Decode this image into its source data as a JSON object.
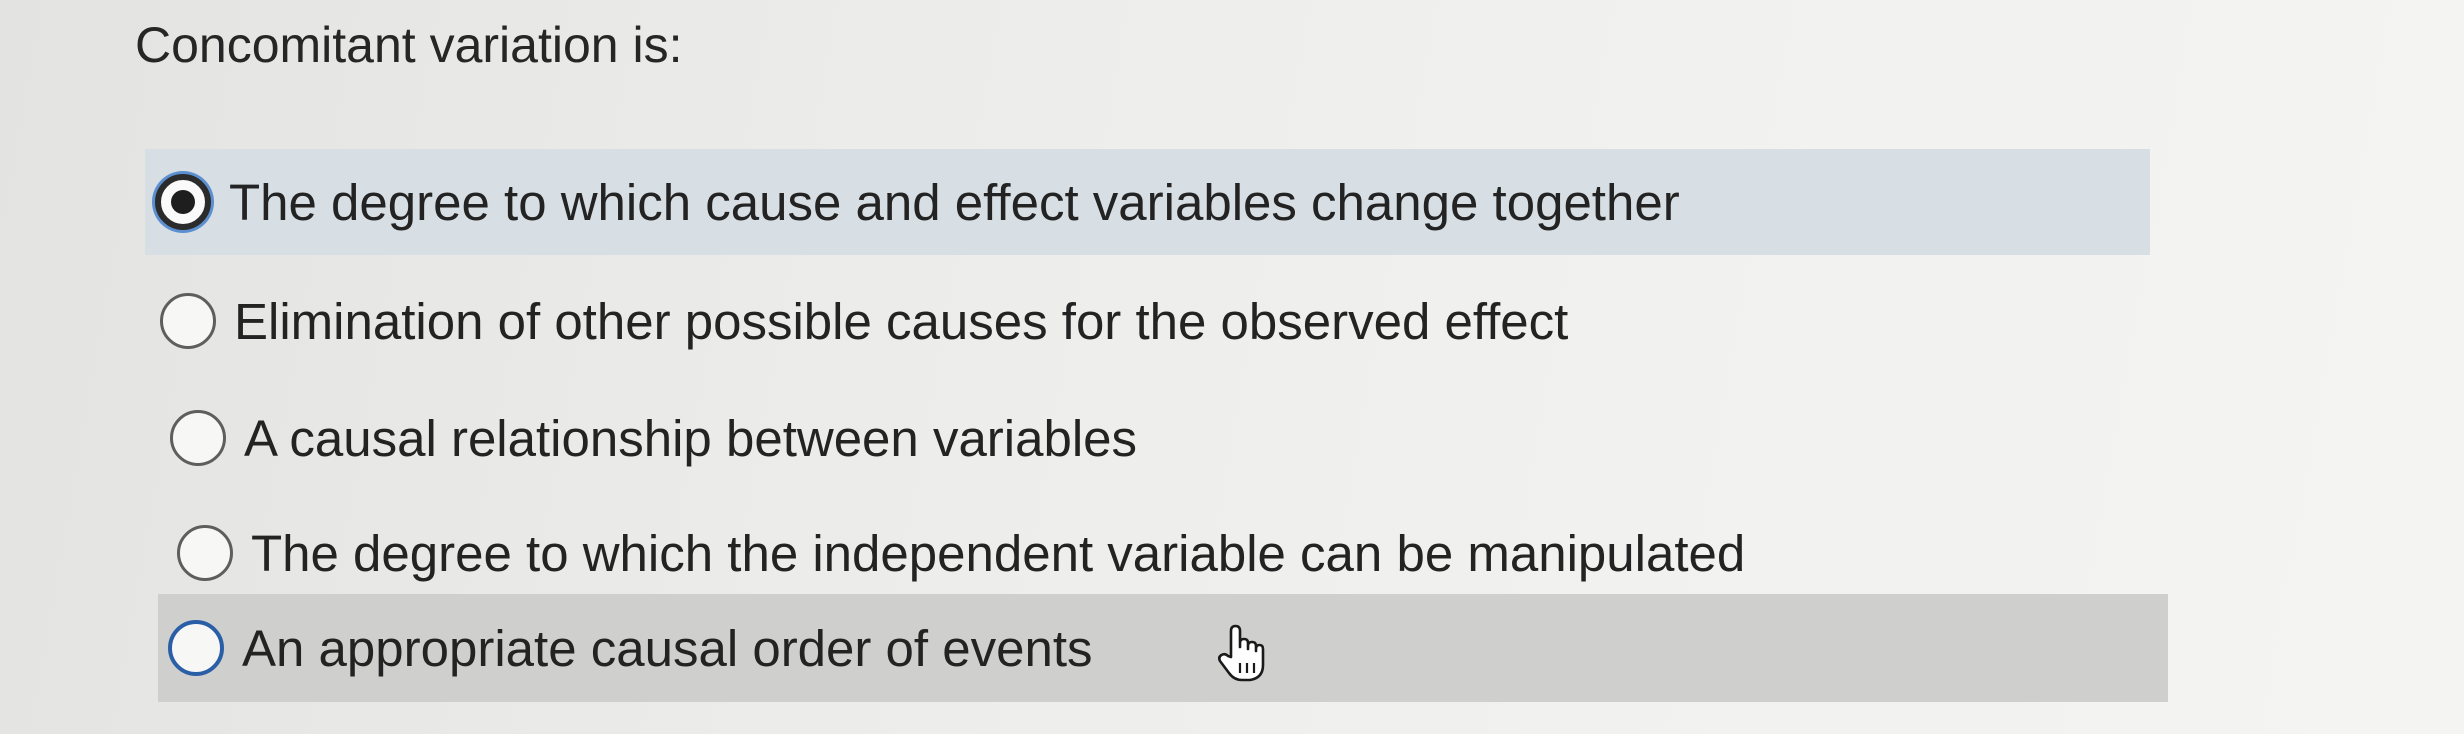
{
  "question": {
    "text": "Concomitant variation is:"
  },
  "options": [
    {
      "label": "The degree to which cause and effect variables change together",
      "selected": true
    },
    {
      "label": "Elimination of other possible causes for the observed effect",
      "selected": false
    },
    {
      "label": "A causal relationship between variables",
      "selected": false
    },
    {
      "label": "The degree to which the independent variable can be manipulated",
      "selected": false
    },
    {
      "label": "An appropriate causal order of events",
      "selected": false,
      "hovered": true
    }
  ],
  "colors": {
    "selected_row_bg": "#d7dfe4",
    "hover_row_bg": "#cfcfcd",
    "focus_ring": "#5b8fd0"
  },
  "icons": {
    "cursor": "hand-pointer-icon"
  }
}
